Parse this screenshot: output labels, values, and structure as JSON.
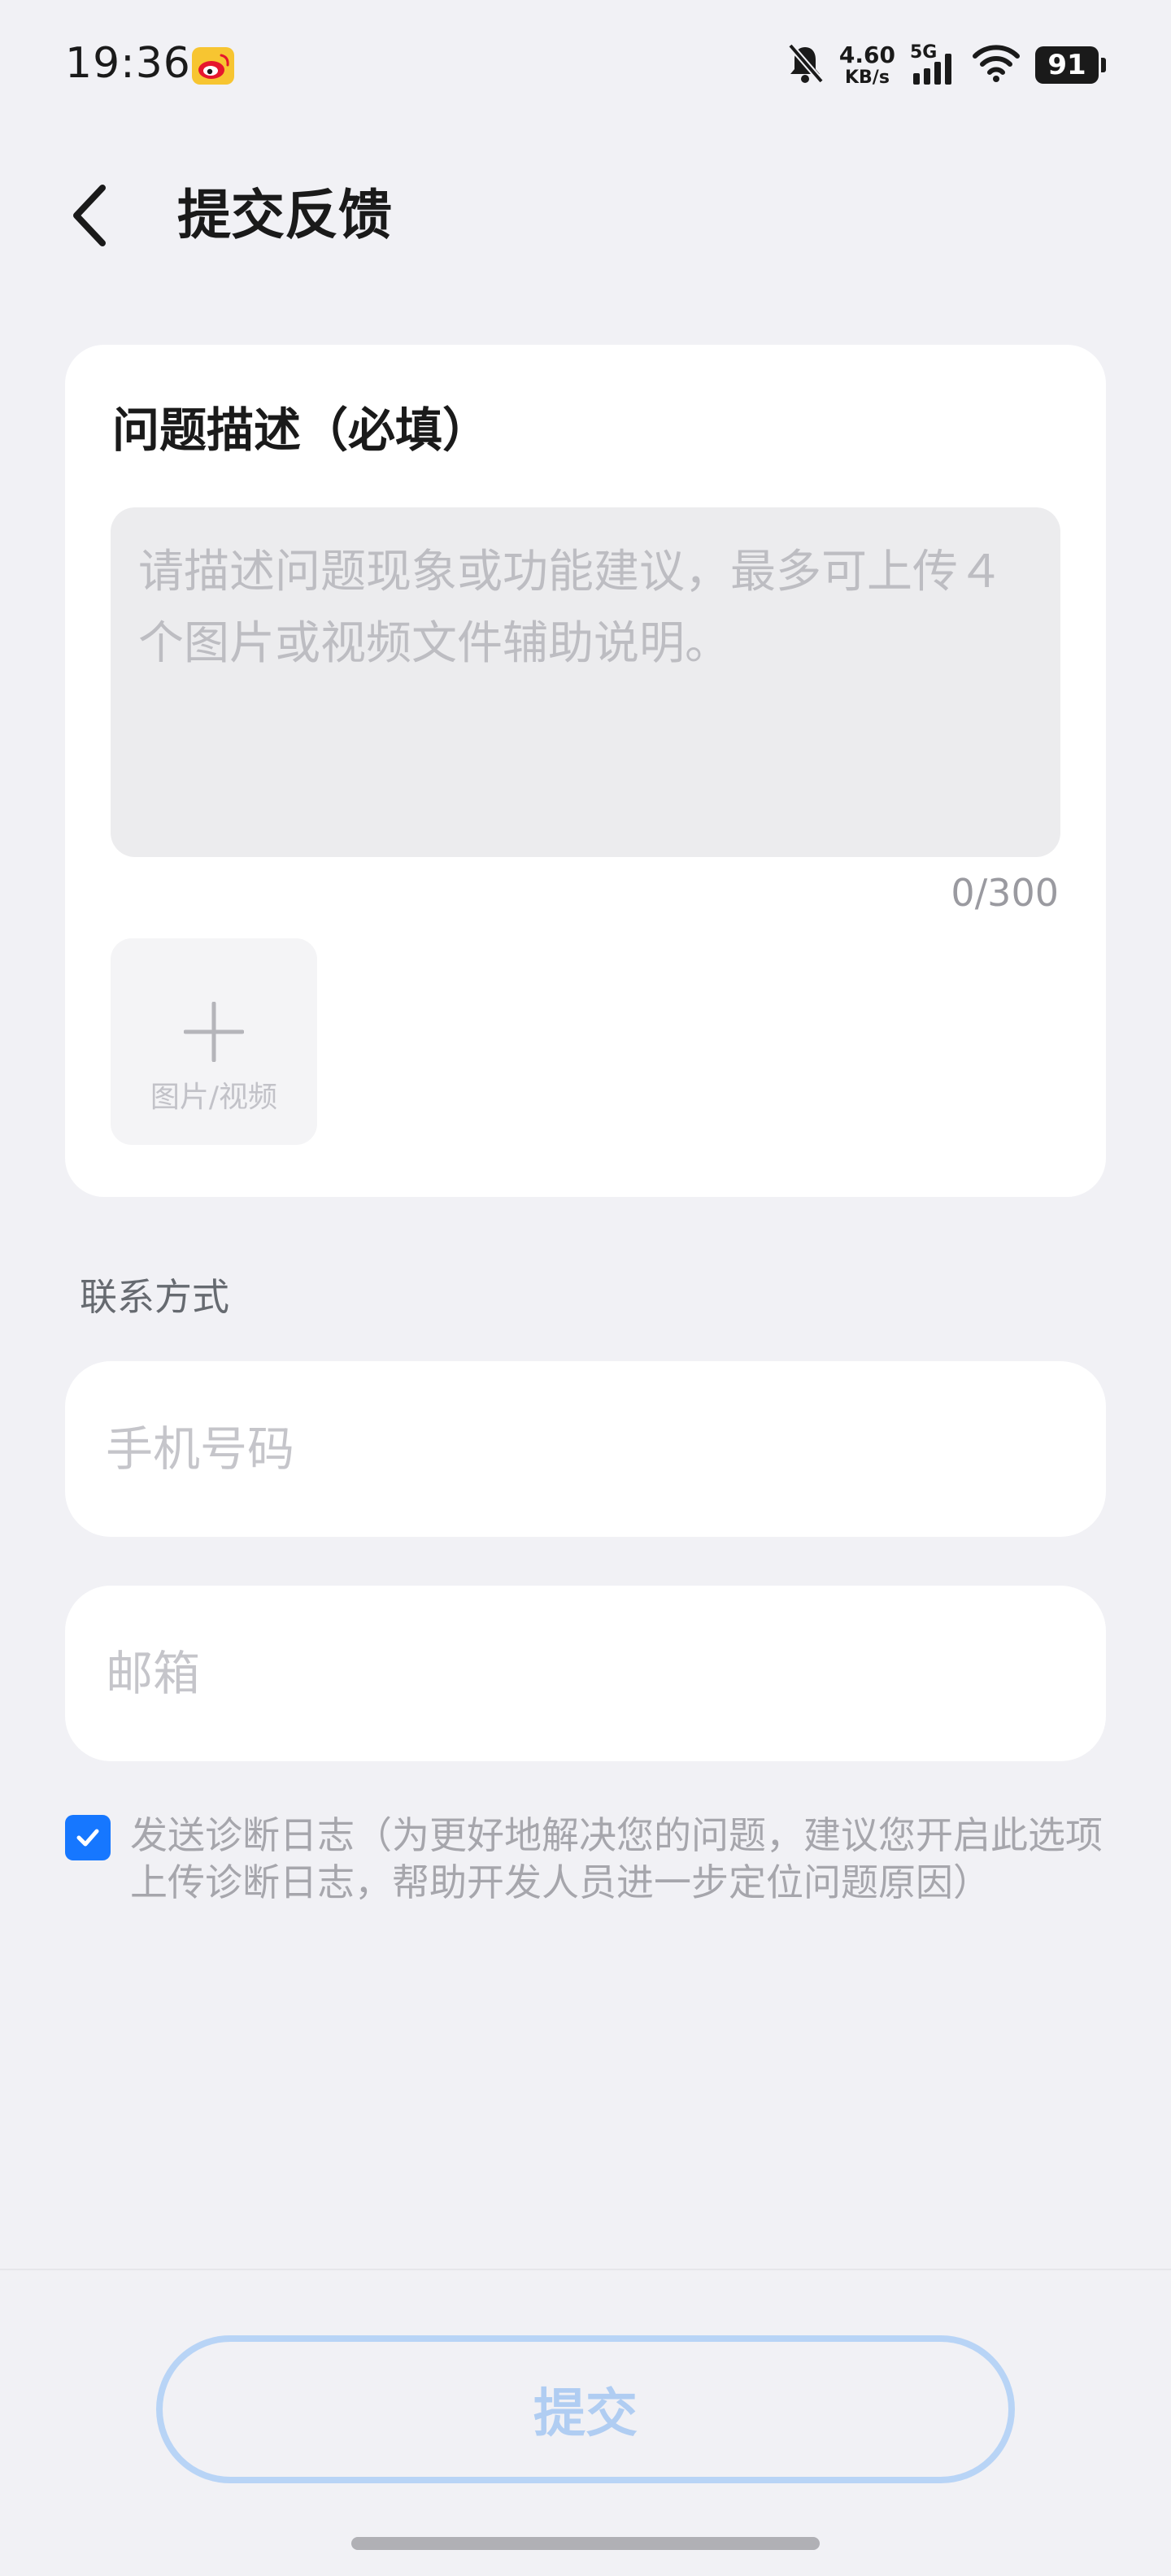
{
  "status_bar": {
    "time": "19:36",
    "net_speed_value": "4.60",
    "net_speed_unit": "KB/s",
    "network_gen": "5G",
    "battery": "91",
    "icons": [
      "weibo-icon",
      "bell-off-icon",
      "signal-icon",
      "wifi-icon",
      "battery-icon"
    ]
  },
  "header": {
    "title": "提交反馈",
    "back_icon": "chevron-left-icon"
  },
  "description": {
    "title": "问题描述（必填）",
    "placeholder": "请描述问题现象或功能建议，最多可上传４个图片或视频文件辅助说明。",
    "char_count": "0/300",
    "add_media_label": "图片/视频"
  },
  "contact": {
    "section_label": "联系方式",
    "phone_placeholder": "手机号码",
    "email_placeholder": "邮箱"
  },
  "diagnostic": {
    "checked": true,
    "text": "发送诊断日志（为更好地解决您的问题，建议您开启此选项上传诊断日志，帮助开发人员进一步定位问题原因）"
  },
  "actions": {
    "submit_label": "提交"
  },
  "colors": {
    "background": "#f1f1f5",
    "accent": "#1677ff",
    "submit_disabled": "#b0cdf2"
  }
}
